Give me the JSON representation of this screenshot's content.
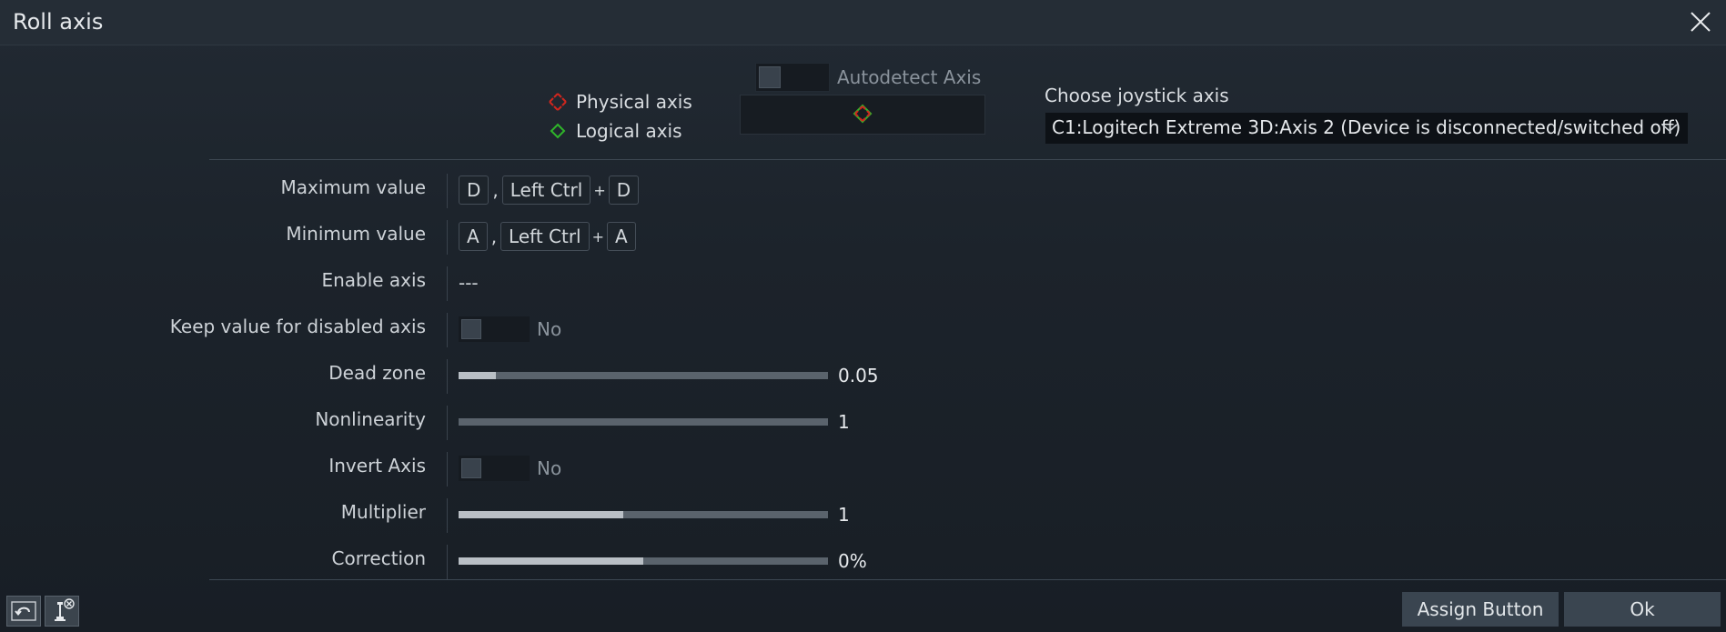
{
  "window": {
    "title": "Roll axis"
  },
  "legend": {
    "physical": "Physical axis",
    "logical": "Logical axis"
  },
  "autodetect": {
    "label": "Autodetect Axis",
    "enabled": false
  },
  "joystick": {
    "label": "Choose joystick axis",
    "selected": "C1:Logitech Extreme 3D:Axis 2 (Device is disconnected/switched off)"
  },
  "rows": {
    "max": {
      "label": "Maximum value",
      "key1": "D",
      "sep": ",",
      "mod": "Left Ctrl",
      "plus": "+",
      "key2": "D"
    },
    "min": {
      "label": "Minimum value",
      "key1": "A",
      "sep": ",",
      "mod": "Left Ctrl",
      "plus": "+",
      "key2": "A"
    },
    "enable": {
      "label": "Enable axis",
      "value": "---"
    },
    "keep": {
      "label": "Keep value for disabled axis",
      "value": "No"
    },
    "deadzone": {
      "label": "Dead zone",
      "value": "0.05",
      "fill": 0.1
    },
    "nonlinearity": {
      "label": "Nonlinearity",
      "value": "1",
      "fill": 0.0
    },
    "invert": {
      "label": "Invert Axis",
      "value": "No"
    },
    "multiplier": {
      "label": "Multiplier",
      "value": "1",
      "fill": 0.445
    },
    "correction": {
      "label": "Correction",
      "value": "0%",
      "fill": 0.5
    }
  },
  "footer": {
    "assign": "Assign Button",
    "ok": "Ok"
  },
  "colors": {
    "physical_marker": "#d0261e",
    "logical_marker": "#2fb52a"
  }
}
